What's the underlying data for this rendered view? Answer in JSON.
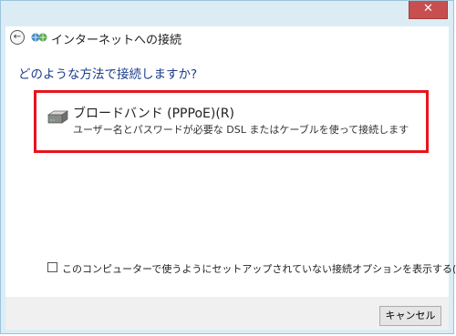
{
  "window": {
    "title": "インターネットへの接続",
    "close_symbol": "✕"
  },
  "nav": {
    "back_symbol": "←"
  },
  "main": {
    "question": "どのような方法で接続しますか?",
    "option": {
      "title": "ブロードバンド (PPPoE)(R)",
      "description": "ユーザー名とパスワードが必要な DSL またはケーブルを使って接続します"
    },
    "checkbox": {
      "label": "このコンピューターで使うようにセットアップされていない接続オプションを表示する(S)",
      "checked": false
    }
  },
  "footer": {
    "cancel_label": "キャンセル"
  },
  "colors": {
    "highlight_border": "#e8141c",
    "close_button": "#c74f4f",
    "question_text": "#1e3c8c"
  }
}
